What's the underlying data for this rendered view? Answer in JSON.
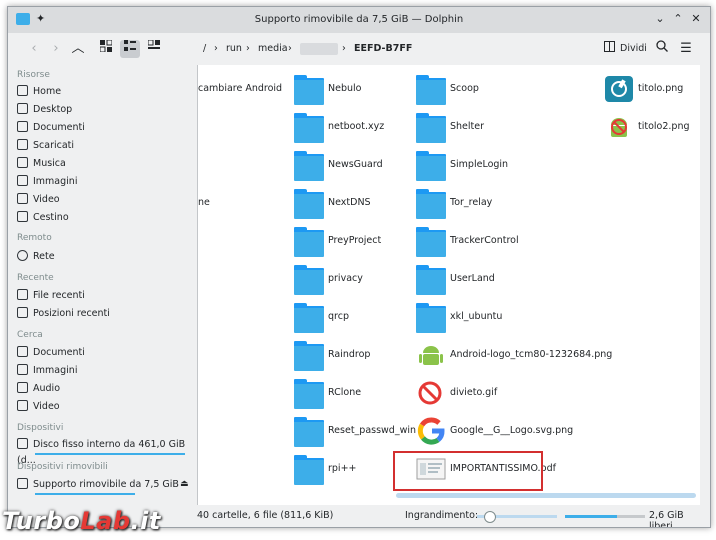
{
  "window": {
    "title": "Supporto rimovibile da 7,5 GiB — Dolphin"
  },
  "toolbar": {
    "breadcrumbs": [
      "/",
      "run",
      "media",
      "EEFD-B7FF"
    ],
    "split_label": "Dividi"
  },
  "sidebar": {
    "sections": {
      "risorse": "Risorse",
      "remoto": "Remoto",
      "recente": "Recente",
      "cerca": "Cerca",
      "dispositivi": "Dispositivi",
      "rimovibili": "Dispositivi rimovibili"
    },
    "risorse_items": [
      "Home",
      "Desktop",
      "Documenti",
      "Scaricati",
      "Musica",
      "Immagini",
      "Video",
      "Cestino"
    ],
    "remoto_items": [
      "Rete"
    ],
    "recente_items": [
      "File recenti",
      "Posizioni recenti"
    ],
    "cerca_items": [
      "Documenti",
      "Immagini",
      "Audio",
      "Video"
    ],
    "dispositivi_items": [
      "Disco fisso interno da 461,0 GiB (d..."
    ],
    "rimovibili_items": [
      "Supporto rimovibile da 7,5 GiB"
    ]
  },
  "files": {
    "col0": [
      "cambiare Android",
      "",
      "",
      "ne"
    ],
    "col1": [
      "Nebulo",
      "netboot.xyz",
      "NewsGuard",
      "NextDNS",
      "PreyProject",
      "privacy",
      "qrcp",
      "Raindrop",
      "RClone",
      "Reset_passwd_win",
      "rpi++"
    ],
    "col2": [
      "Scoop",
      "Shelter",
      "SimpleLogin",
      "Tor_relay",
      "TrackerControl",
      "UserLand",
      "xkl_ubuntu",
      "Android-logo_tcm80-1232684.png",
      "divieto.gif",
      "Google__G__Logo.svg.png",
      "IMPORTANTISSIMO.pdf"
    ],
    "col3": [
      "titolo.png",
      "titolo2.png"
    ]
  },
  "status": {
    "summary": "40 cartelle, 6 file (811,6 KiB)",
    "zoom_label": "Ingrandimento:",
    "free_space": "2,6 GiB liberi",
    "zoom_level": 0.15,
    "free_fraction": 0.35
  },
  "watermark": {
    "part1": "Turbo",
    "part2": "Lab",
    "part3": ".it"
  },
  "colors": {
    "accent": "#3daee9",
    "highlight_box": "#d32f2f"
  }
}
